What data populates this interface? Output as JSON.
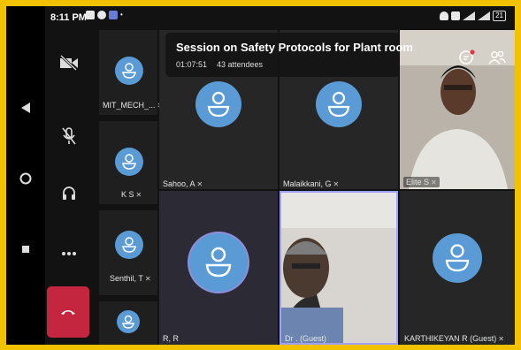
{
  "status_bar": {
    "time": "8:11 PM",
    "battery": "21"
  },
  "meeting": {
    "title": "Session on Safety Protocols for Plant room",
    "elapsed": "01:07:51",
    "attendees": "43 attendees"
  },
  "side_participants": [
    {
      "name": "MIT_MECH_..."
    },
    {
      "name": "K S"
    },
    {
      "name": "Senthil, T"
    },
    {
      "name": ""
    }
  ],
  "grid_participants": {
    "sahoo": "Sahoo, A",
    "malaikkani": "Malaikkani, G",
    "elite": "Elite S",
    "rr": "R, R",
    "dr": "Dr . (Guest)",
    "karthikeyan": "KARTHIKEYAN R (Guest)"
  },
  "colors": {
    "avatar": "#5b9bd5",
    "hangup": "#c4263f",
    "border": "#f2c200"
  }
}
